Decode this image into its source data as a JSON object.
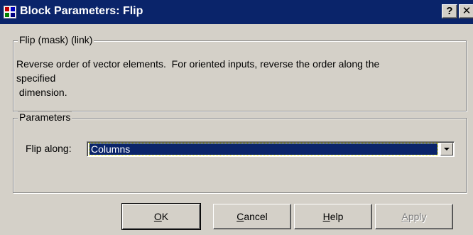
{
  "window": {
    "title": "Block Parameters: Flip",
    "help_glyph": "?",
    "close_glyph": "✕"
  },
  "description_group": {
    "label": "Flip (mask) (link)",
    "text": "Reverse order of vector elements.  For oriented inputs, reverse the order along the\nspecified\n dimension."
  },
  "parameters_group": {
    "label": "Parameters",
    "flip_along": {
      "label": "Flip along:",
      "value": "Columns"
    }
  },
  "buttons": {
    "ok": {
      "mnemonic": "O",
      "rest": "K"
    },
    "cancel": {
      "mnemonic": "C",
      "rest": "ancel"
    },
    "help": {
      "mnemonic": "H",
      "rest": "elp"
    },
    "apply": {
      "mnemonic": "A",
      "rest": "pply"
    }
  },
  "colors": {
    "titlebar": "#0a246a",
    "face": "#d4d0c8",
    "selection": "#0a246a"
  },
  "icons": {
    "app": "simulink-block-icon",
    "dropdown": "chevron-down-icon"
  }
}
